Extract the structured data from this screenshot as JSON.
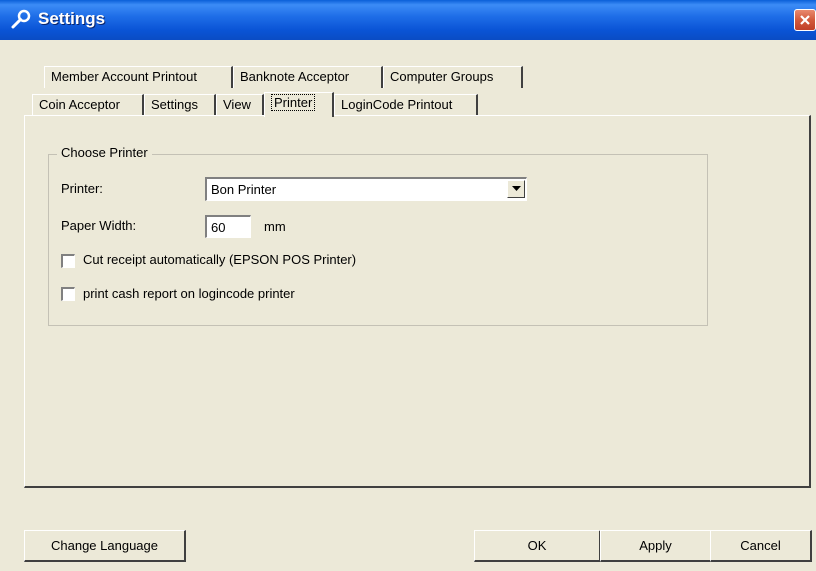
{
  "window": {
    "title": "Settings"
  },
  "tabs_row1": [
    {
      "label": "Member Account Printout"
    },
    {
      "label": "Banknote Acceptor"
    },
    {
      "label": "Computer Groups"
    }
  ],
  "tabs_row2": [
    {
      "label": "Coin Acceptor"
    },
    {
      "label": "Settings"
    },
    {
      "label": "View"
    },
    {
      "label": "Printer",
      "active": true
    },
    {
      "label": "LoginCode Printout"
    }
  ],
  "printer_group": {
    "legend": "Choose Printer",
    "printer_label": "Printer:",
    "printer_value": "Bon Printer",
    "paper_width_label": "Paper Width:",
    "paper_width_value": "60",
    "paper_width_unit": "mm",
    "cut_receipt_label": "Cut receipt automatically (EPSON POS Printer)",
    "cut_receipt_checked": false,
    "cash_report_label": "print cash report on logincode printer",
    "cash_report_checked": false
  },
  "buttons": {
    "change_language": "Change Language",
    "ok": "OK",
    "apply": "Apply",
    "cancel": "Cancel"
  }
}
